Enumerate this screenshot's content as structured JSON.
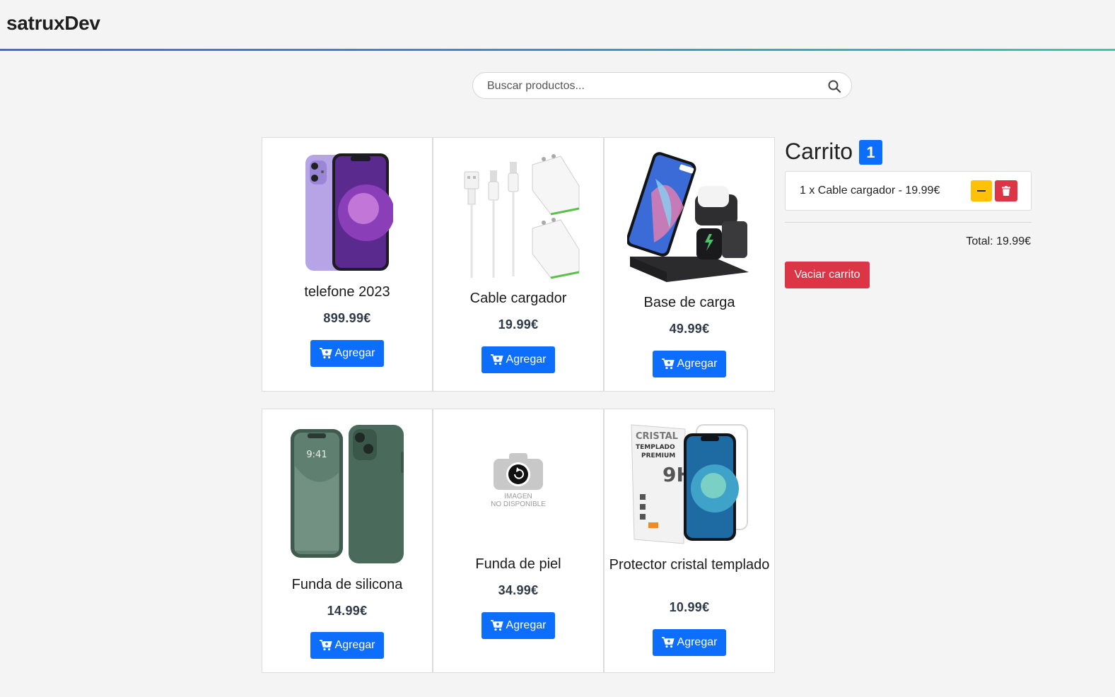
{
  "header": {
    "brand": "satruxDev"
  },
  "search": {
    "placeholder": "Buscar productos..."
  },
  "products": [
    {
      "name": "telefone 2023",
      "price": "899.99€",
      "add_label": "Agregar",
      "image_icon": "purple-phone-image"
    },
    {
      "name": "Cable cargador",
      "price": "19.99€",
      "add_label": "Agregar",
      "image_icon": "charger-cable-image"
    },
    {
      "name": "Base de carga",
      "price": "49.99€",
      "add_label": "Agregar",
      "image_icon": "charging-dock-image"
    },
    {
      "name": "Funda de silicona",
      "price": "14.99€",
      "add_label": "Agregar",
      "image_icon": "green-case-image"
    },
    {
      "name": "Funda de piel",
      "price": "34.99€",
      "add_label": "Agregar",
      "image_icon": "image-unavailable",
      "placeholder_line1": "IMAGEN",
      "placeholder_line2": "NO DISPONIBLE"
    },
    {
      "name": "Protector cristal templado",
      "price": "10.99€",
      "add_label": "Agregar",
      "image_icon": "screen-protector-image",
      "box_line1": "CRISTAL",
      "box_line2": "TEMPLADO",
      "box_line3": "PREMIUM",
      "box_line4": "9H+"
    }
  ],
  "cart": {
    "title": "Carrito",
    "count": "1",
    "items": [
      {
        "text": "1 x Cable cargador - 19.99€"
      }
    ],
    "total": "Total: 19.99€",
    "clear_label": "Vaciar carrito"
  },
  "colors": {
    "primary": "#0d6efd",
    "danger": "#dc3545",
    "warning": "#ffc107",
    "background": "#f4f4f4"
  }
}
